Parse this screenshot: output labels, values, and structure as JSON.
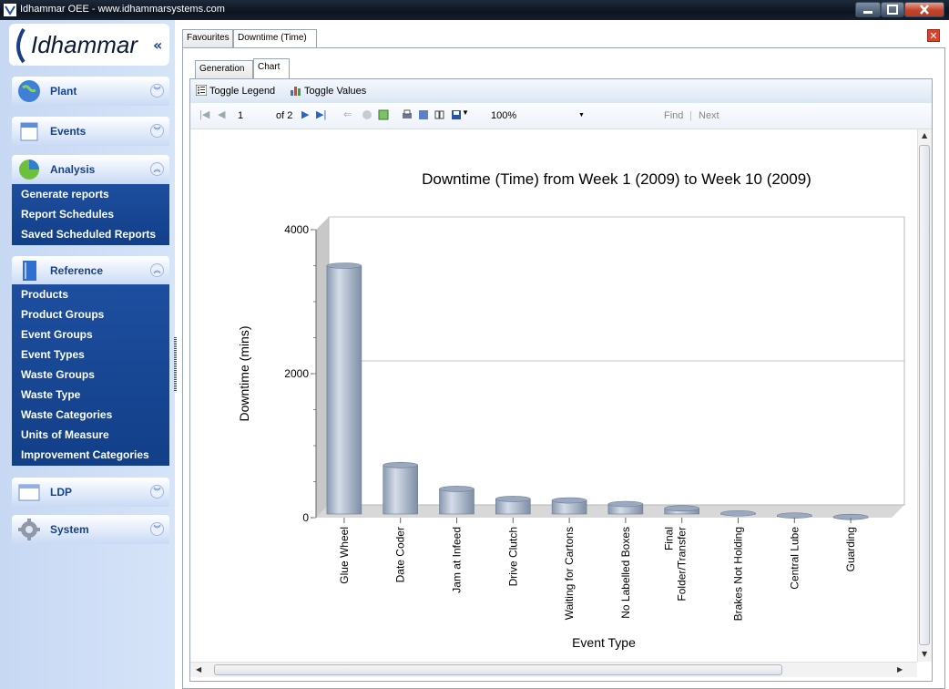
{
  "window": {
    "title": "Idhammar OEE - www.idhammarsystems.com"
  },
  "sidebar": {
    "logo_text": "Idhammar",
    "collapse_glyph": "«",
    "groups": [
      {
        "label": "Plant",
        "icon": "globe-icon",
        "expanded": false,
        "items": []
      },
      {
        "label": "Events",
        "icon": "calendar-icon",
        "expanded": false,
        "items": []
      },
      {
        "label": "Analysis",
        "icon": "pie-chart-icon",
        "expanded": true,
        "items": [
          "Generate reports",
          "Report Schedules",
          "Saved Scheduled Reports"
        ]
      },
      {
        "label": "Reference",
        "icon": "book-icon",
        "expanded": true,
        "items": [
          "Products",
          "Product Groups",
          "Event Groups",
          "Event Types",
          "Waste Groups",
          "Waste Type",
          "Waste Categories",
          "Units of Measure",
          "Improvement Categories"
        ]
      },
      {
        "label": "LDP",
        "icon": "window-icon",
        "expanded": false,
        "items": []
      },
      {
        "label": "System",
        "icon": "gear-icon",
        "expanded": false,
        "items": []
      }
    ]
  },
  "tabs": {
    "favourites": "Favourites",
    "downtime": "Downtime (Time)"
  },
  "inner_tabs": {
    "generation": "Generation",
    "chart": "Chart"
  },
  "toggles": {
    "legend": "Toggle Legend",
    "values": "Toggle Values"
  },
  "report_toolbar": {
    "page": "1",
    "of_pages": "of 2",
    "zoom": "100%",
    "find": "Find",
    "next": "Next"
  },
  "chart_data": {
    "type": "bar",
    "title": "Downtime (Time) from Week 1 (2009) to Week 10 (2009)",
    "xlabel": "Event Type",
    "ylabel": "Downtime (mins)",
    "ylim": [
      0,
      4000
    ],
    "yticks": [
      "0",
      "2000",
      "4000"
    ],
    "grid": true,
    "categories": [
      "Glue Wheel",
      "Date Coder",
      "Jam at Infeed",
      "Drive Clutch",
      "Waiting for Cartons",
      "No Labelled Boxes",
      "Final Folder/Transfer",
      "Brakes Not Holding",
      "Central Lube",
      "Guarding"
    ],
    "category_lines": [
      [
        "Glue Wheel"
      ],
      [
        "Date Coder"
      ],
      [
        "Jam at Infeed"
      ],
      [
        "Drive Clutch"
      ],
      [
        "Waiting for Cartons"
      ],
      [
        "No Labelled Boxes"
      ],
      [
        "Final",
        "Folder/Transfer"
      ],
      [
        "Brakes Not Holding"
      ],
      [
        "Central Lube"
      ],
      [
        "Guarding"
      ]
    ],
    "values": [
      3500,
      730,
      400,
      260,
      240,
      190,
      130,
      60,
      30,
      10
    ],
    "bar_color": "#a9b8cc"
  }
}
